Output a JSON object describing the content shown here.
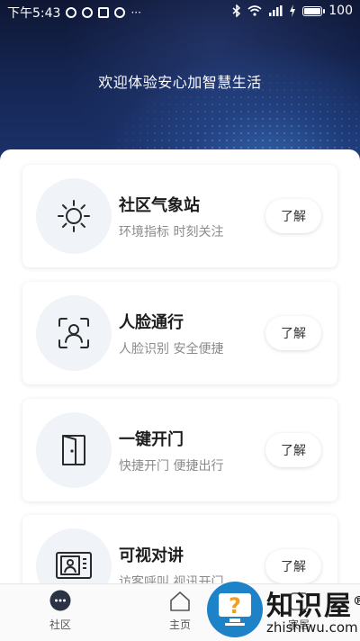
{
  "status_bar": {
    "time": "下午5:43",
    "battery": "100",
    "more": "···"
  },
  "header": {
    "welcome": "欢迎体验安心加智慧生活"
  },
  "cards": [
    {
      "title": "社区气象站",
      "subtitle": "环境指标 时刻关注",
      "button": "了解",
      "icon": "sun-icon"
    },
    {
      "title": "人脸通行",
      "subtitle": "人脸识别 安全便捷",
      "button": "了解",
      "icon": "face-scan-icon"
    },
    {
      "title": "一键开门",
      "subtitle": "快捷开门 便捷出行",
      "button": "了解",
      "icon": "door-icon"
    },
    {
      "title": "可视对讲",
      "subtitle": "访客呼叫 视讯开门",
      "button": "了解",
      "icon": "intercom-icon"
    }
  ],
  "bottom_nav": [
    {
      "label": "社区",
      "icon": "chat-bubble-icon"
    },
    {
      "label": "主页",
      "icon": "home-icon"
    },
    {
      "label": "家居",
      "icon": "smart-home-icon"
    }
  ],
  "watermark": {
    "title": "知识屋",
    "subtitle": "zhishiwu.com",
    "registered": "®"
  },
  "colors": {
    "header_dark": "#0e1633",
    "accent_blue": "#1e82c8",
    "card_icon_bg": "#f0f3f7"
  }
}
